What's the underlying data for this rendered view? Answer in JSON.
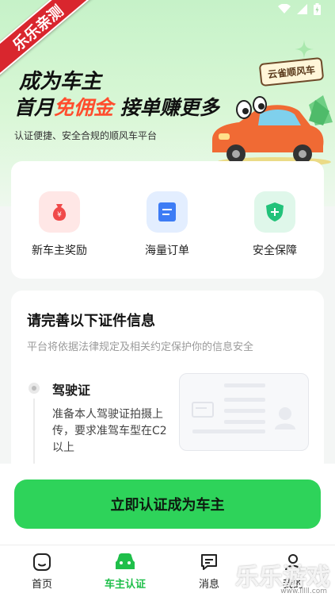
{
  "watermark_ribbon": "乐乐亲测",
  "hero": {
    "title_line1": "成为车主",
    "title_line2_a": "首月",
    "title_line2_highlight": "免佣金",
    "title_line2_b": " 接单赚更多",
    "subtitle": "认证便捷、安全合规的顺风车平台",
    "brand_tag": "云雀顺风车"
  },
  "benefits": [
    {
      "label": "新车主奖励",
      "icon": "money-bag-icon",
      "bg": "#ffe7e6",
      "color": "#f04a4a"
    },
    {
      "label": "海量订单",
      "icon": "order-list-icon",
      "bg": "#e3eeff",
      "color": "#3d7cf5"
    },
    {
      "label": "安全保障",
      "icon": "shield-plus-icon",
      "bg": "#dff7ea",
      "color": "#22c27a"
    }
  ],
  "cert": {
    "title": "请完善以下证件信息",
    "subtitle": "平台将依据法律规定及相关约定保护你的信息安全",
    "step_name": "驾驶证",
    "step_desc": "准备本人驾驶证拍摄上传，要求准驾车型在C2以上"
  },
  "cta_label": "立即认证成为车主",
  "tabs": [
    {
      "label": "首页",
      "icon": "home-icon"
    },
    {
      "label": "车主认证",
      "icon": "car-icon",
      "active": true
    },
    {
      "label": "消息",
      "icon": "message-icon"
    },
    {
      "label": "我的",
      "icon": "user-icon"
    }
  ],
  "bottom_watermark": "乐乐游戏",
  "bottom_watermark_url": "www.lllll.com",
  "colors": {
    "accent": "#2ed35a",
    "highlight": "#ff4d2e"
  }
}
